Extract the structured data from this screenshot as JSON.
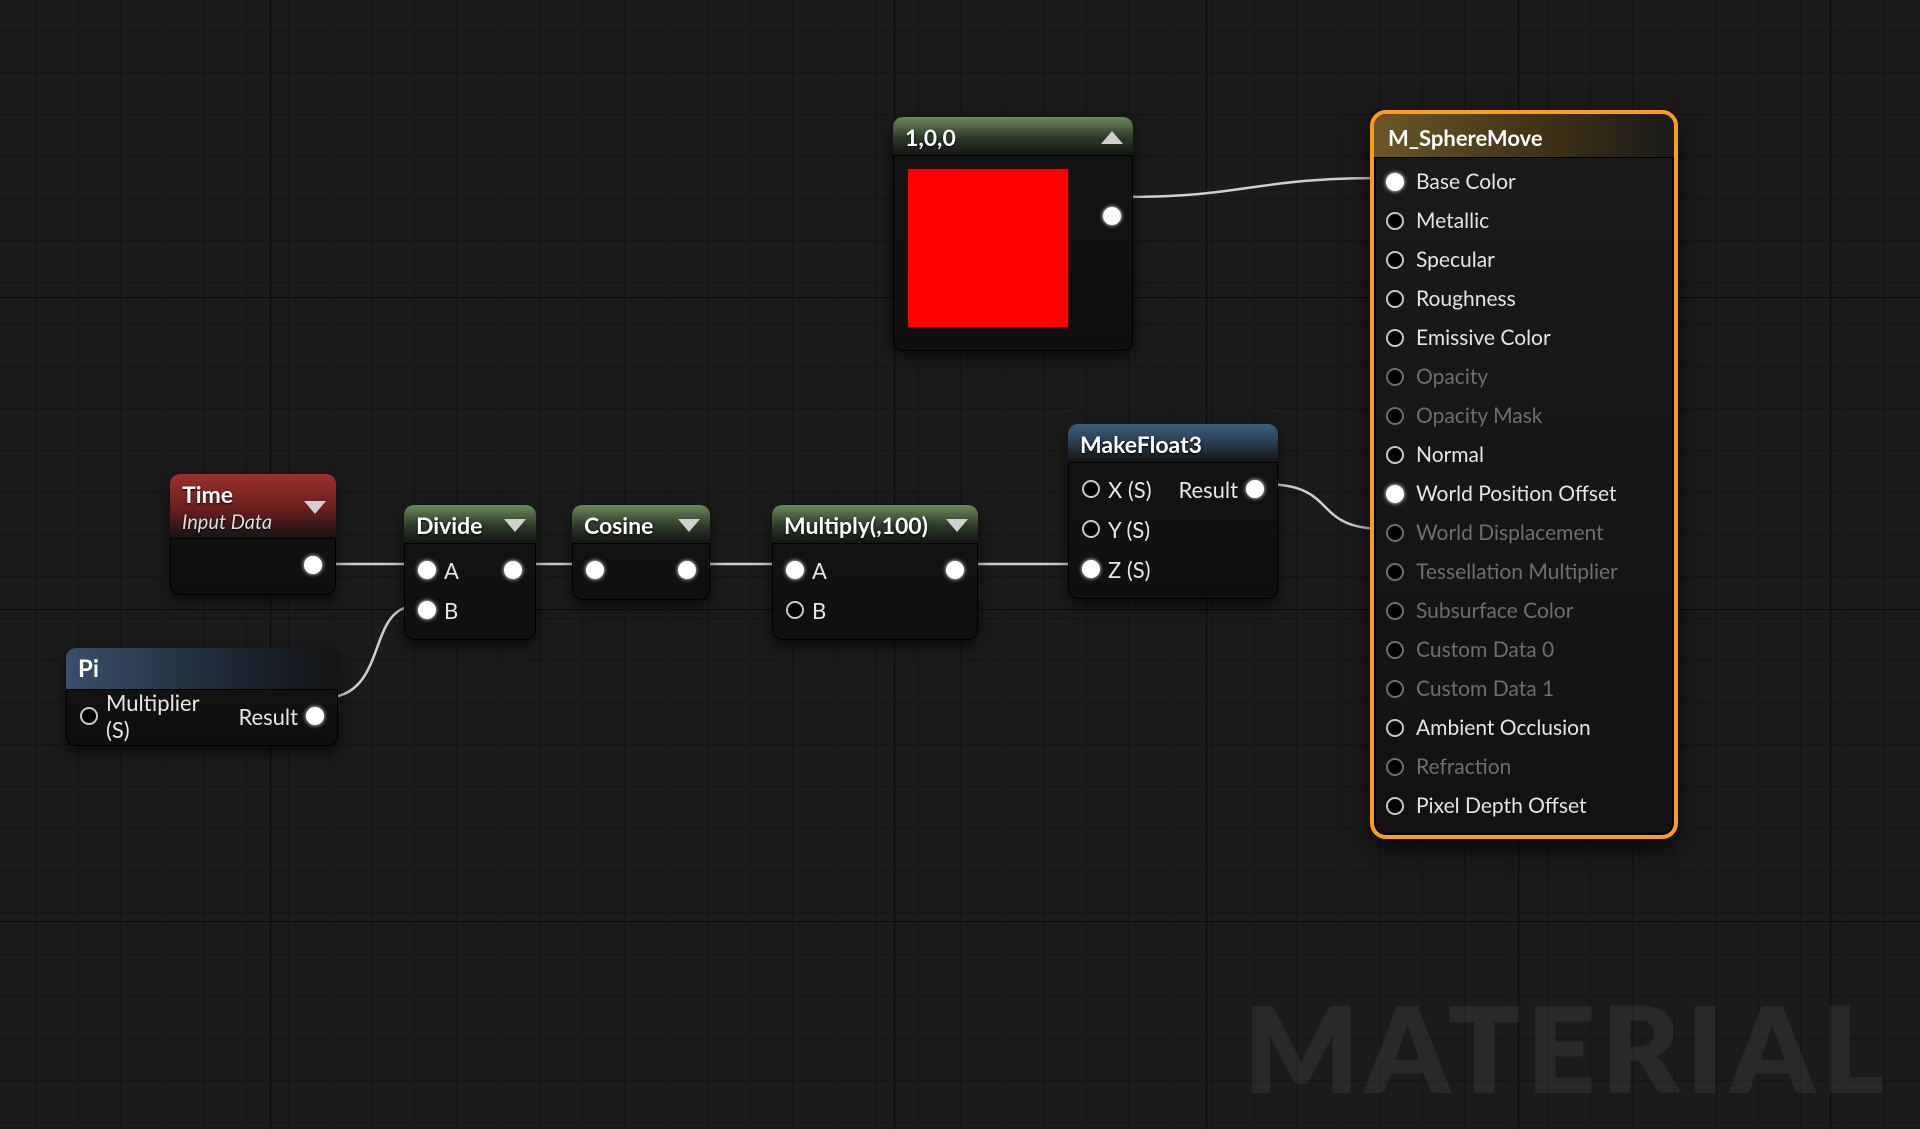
{
  "watermark": "MATERIAL",
  "nodes": {
    "time": {
      "title": "Time",
      "subtitle": "Input Data"
    },
    "pi": {
      "title": "Pi",
      "inLabel": "Multiplier (S)",
      "outLabel": "Result"
    },
    "divide": {
      "title": "Divide",
      "inA": "A",
      "inB": "B"
    },
    "cosine": {
      "title": "Cosine"
    },
    "multiply": {
      "title": "Multiply(,100)",
      "inA": "A",
      "inB": "B"
    },
    "makefloat3": {
      "title": "MakeFloat3",
      "inX": "X (S)",
      "inY": "Y (S)",
      "inZ": "Z (S)",
      "outLabel": "Result"
    },
    "const": {
      "title": "1,0,0",
      "color": "#ff0101"
    }
  },
  "material": {
    "title": "M_SphereMove",
    "inputs": [
      {
        "label": "Base Color",
        "enabled": true,
        "connected": true
      },
      {
        "label": "Metallic",
        "enabled": true,
        "connected": false
      },
      {
        "label": "Specular",
        "enabled": true,
        "connected": false
      },
      {
        "label": "Roughness",
        "enabled": true,
        "connected": false
      },
      {
        "label": "Emissive Color",
        "enabled": true,
        "connected": false
      },
      {
        "label": "Opacity",
        "enabled": false,
        "connected": false
      },
      {
        "label": "Opacity Mask",
        "enabled": false,
        "connected": false
      },
      {
        "label": "Normal",
        "enabled": true,
        "connected": false
      },
      {
        "label": "World Position Offset",
        "enabled": true,
        "connected": true
      },
      {
        "label": "World Displacement",
        "enabled": false,
        "connected": false
      },
      {
        "label": "Tessellation Multiplier",
        "enabled": false,
        "connected": false
      },
      {
        "label": "Subsurface Color",
        "enabled": false,
        "connected": false
      },
      {
        "label": "Custom Data 0",
        "enabled": false,
        "connected": false
      },
      {
        "label": "Custom Data 1",
        "enabled": false,
        "connected": false
      },
      {
        "label": "Ambient Occlusion",
        "enabled": true,
        "connected": false
      },
      {
        "label": "Refraction",
        "enabled": false,
        "connected": false
      },
      {
        "label": "Pixel Depth Offset",
        "enabled": true,
        "connected": false
      }
    ]
  }
}
